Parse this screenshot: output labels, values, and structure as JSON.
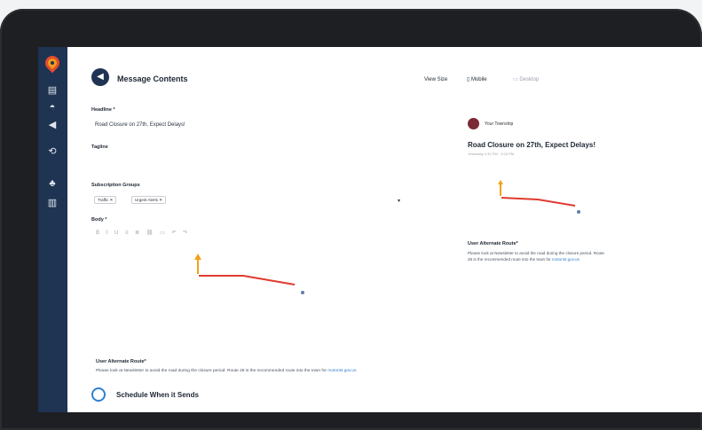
{
  "header": {
    "title": "Message Contents",
    "view_size_label": "View Size",
    "mobile_label": "Mobile",
    "desktop_label": "Desktop"
  },
  "form": {
    "headline_label": "Headline *",
    "headline_value": "Road Closure on 27th, Expect Delays!",
    "tagline_label": "Tagline",
    "subscription_label": "Subscription Groups",
    "tags": [
      "Traffic",
      "Urgent Alerts"
    ],
    "body_label": "Body *",
    "toolbar_glyphs": "B I U ≡ ≣ ⛓ ▭ ↶ ↷",
    "alt_route_title": "User Alternate Route*",
    "alt_route_body": "Please look at Newsletter to avoid the road during the closure period. Route 28 is the recommended route into the town for",
    "alt_route_link": "motorist.gov.us"
  },
  "schedule": {
    "title": "Schedule When it Sends"
  },
  "preview": {
    "from": "Your Township",
    "title": "Road Closure on 27th, Expect Delays!",
    "date": "Yesterday 4:32 PM · 2:02 PM",
    "alt_route_title": "User Alternate Route*",
    "alt_route_body": "Please look at Newsletter to avoid the road during the closure period. Route 28 is the recommended route into the town for",
    "alt_route_link": "motorist.gov.us"
  },
  "sidebar": {
    "icons": [
      "dashboard-icon",
      "alerts-icon",
      "megaphone-icon",
      "broadcast-icon",
      "subscribers-icon",
      "analytics-icon"
    ]
  },
  "colors": {
    "sidebar": "#1f3352",
    "accent": "#2f7fd1",
    "route_line": "#e03a2f",
    "arrow": "#f0a21a"
  }
}
